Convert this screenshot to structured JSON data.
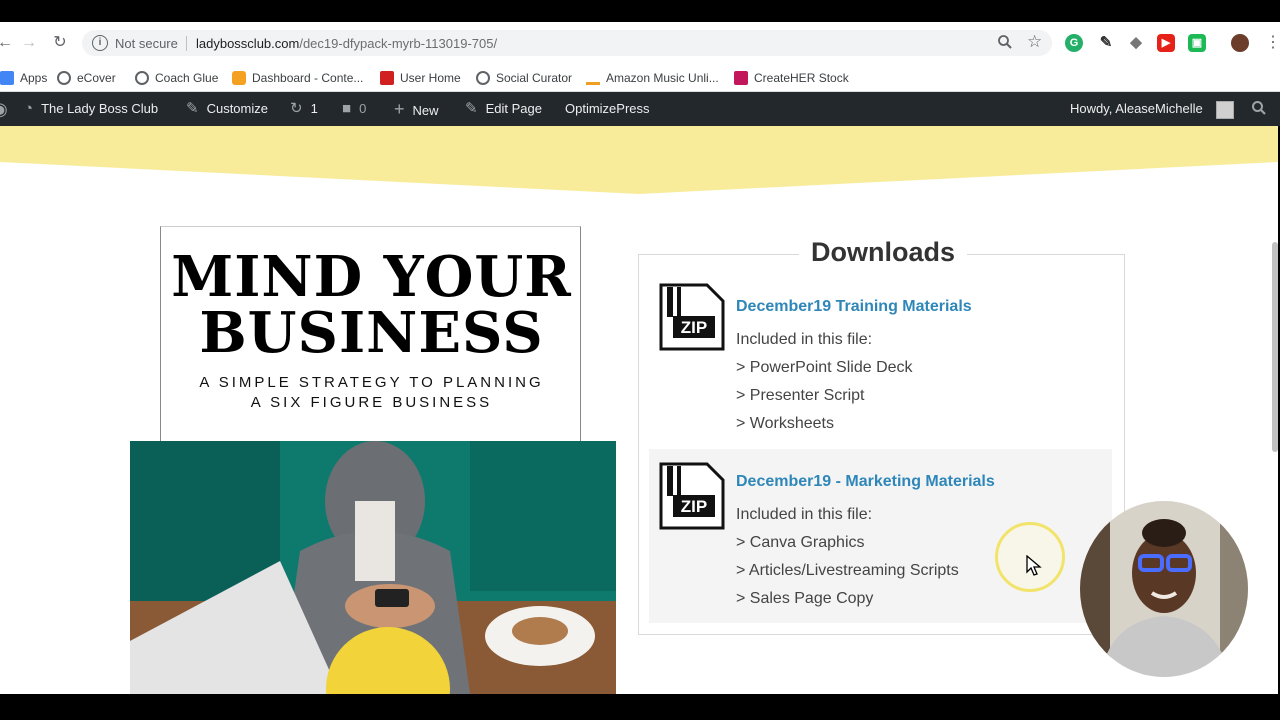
{
  "browser": {
    "security_label": "Not secure",
    "url_domain": "ladybossclub.com",
    "url_path": "/dec19-dfypack-myrb-113019-705/"
  },
  "bookmarks": [
    {
      "label": "Apps",
      "icon": "apps-grid-icon",
      "color": "#4285f4"
    },
    {
      "label": "eCover",
      "icon": "globe-icon",
      "color": "#5f6368"
    },
    {
      "label": "Coach Glue",
      "icon": "globe-icon",
      "color": "#5f6368"
    },
    {
      "label": "Dashboard - Conte...",
      "icon": "joomla-icon",
      "color": "#f4a020"
    },
    {
      "label": "User Home",
      "icon": "id-badge-icon",
      "color": "#d02020"
    },
    {
      "label": "Social Curator",
      "icon": "globe-icon",
      "color": "#5f6368"
    },
    {
      "label": "Amazon Music Unli...",
      "icon": "amazon-icon",
      "color": "#222222"
    },
    {
      "label": "CreateHER Stock",
      "icon": "createher-icon",
      "color": "#c2185b"
    }
  ],
  "admin_bar": {
    "site_name": "The Lady Boss Club",
    "customize": "Customize",
    "updates_count": "1",
    "comments_count": "0",
    "new_label": "New",
    "edit_page": "Edit Page",
    "optimizepress": "OptimizePress",
    "howdy": "Howdy, AleaseMichelle"
  },
  "ebook": {
    "title_line1": "MIND YOUR",
    "title_line2": "BUSINESS",
    "subtitle_line1": "A SIMPLE STRATEGY TO PLANNING",
    "subtitle_line2": "A SIX FIGURE BUSINESS"
  },
  "downloads": {
    "heading": "Downloads",
    "items": [
      {
        "title": "December19 Training Materials",
        "intro": "Included in this file:",
        "lines": [
          "> PowerPoint Slide Deck",
          "> Presenter Script",
          "> Worksheets"
        ]
      },
      {
        "title": "December19 - Marketing Materials",
        "intro": "Included in this file:",
        "lines": [
          "> Canva Graphics",
          "> Articles/Livestreaming Scripts",
          "> Sales Page Copy"
        ]
      }
    ]
  },
  "colors": {
    "accent_yellow": "#f8ec9a",
    "link_blue": "#2e87b8",
    "admin_bar_bg": "#23282d"
  }
}
